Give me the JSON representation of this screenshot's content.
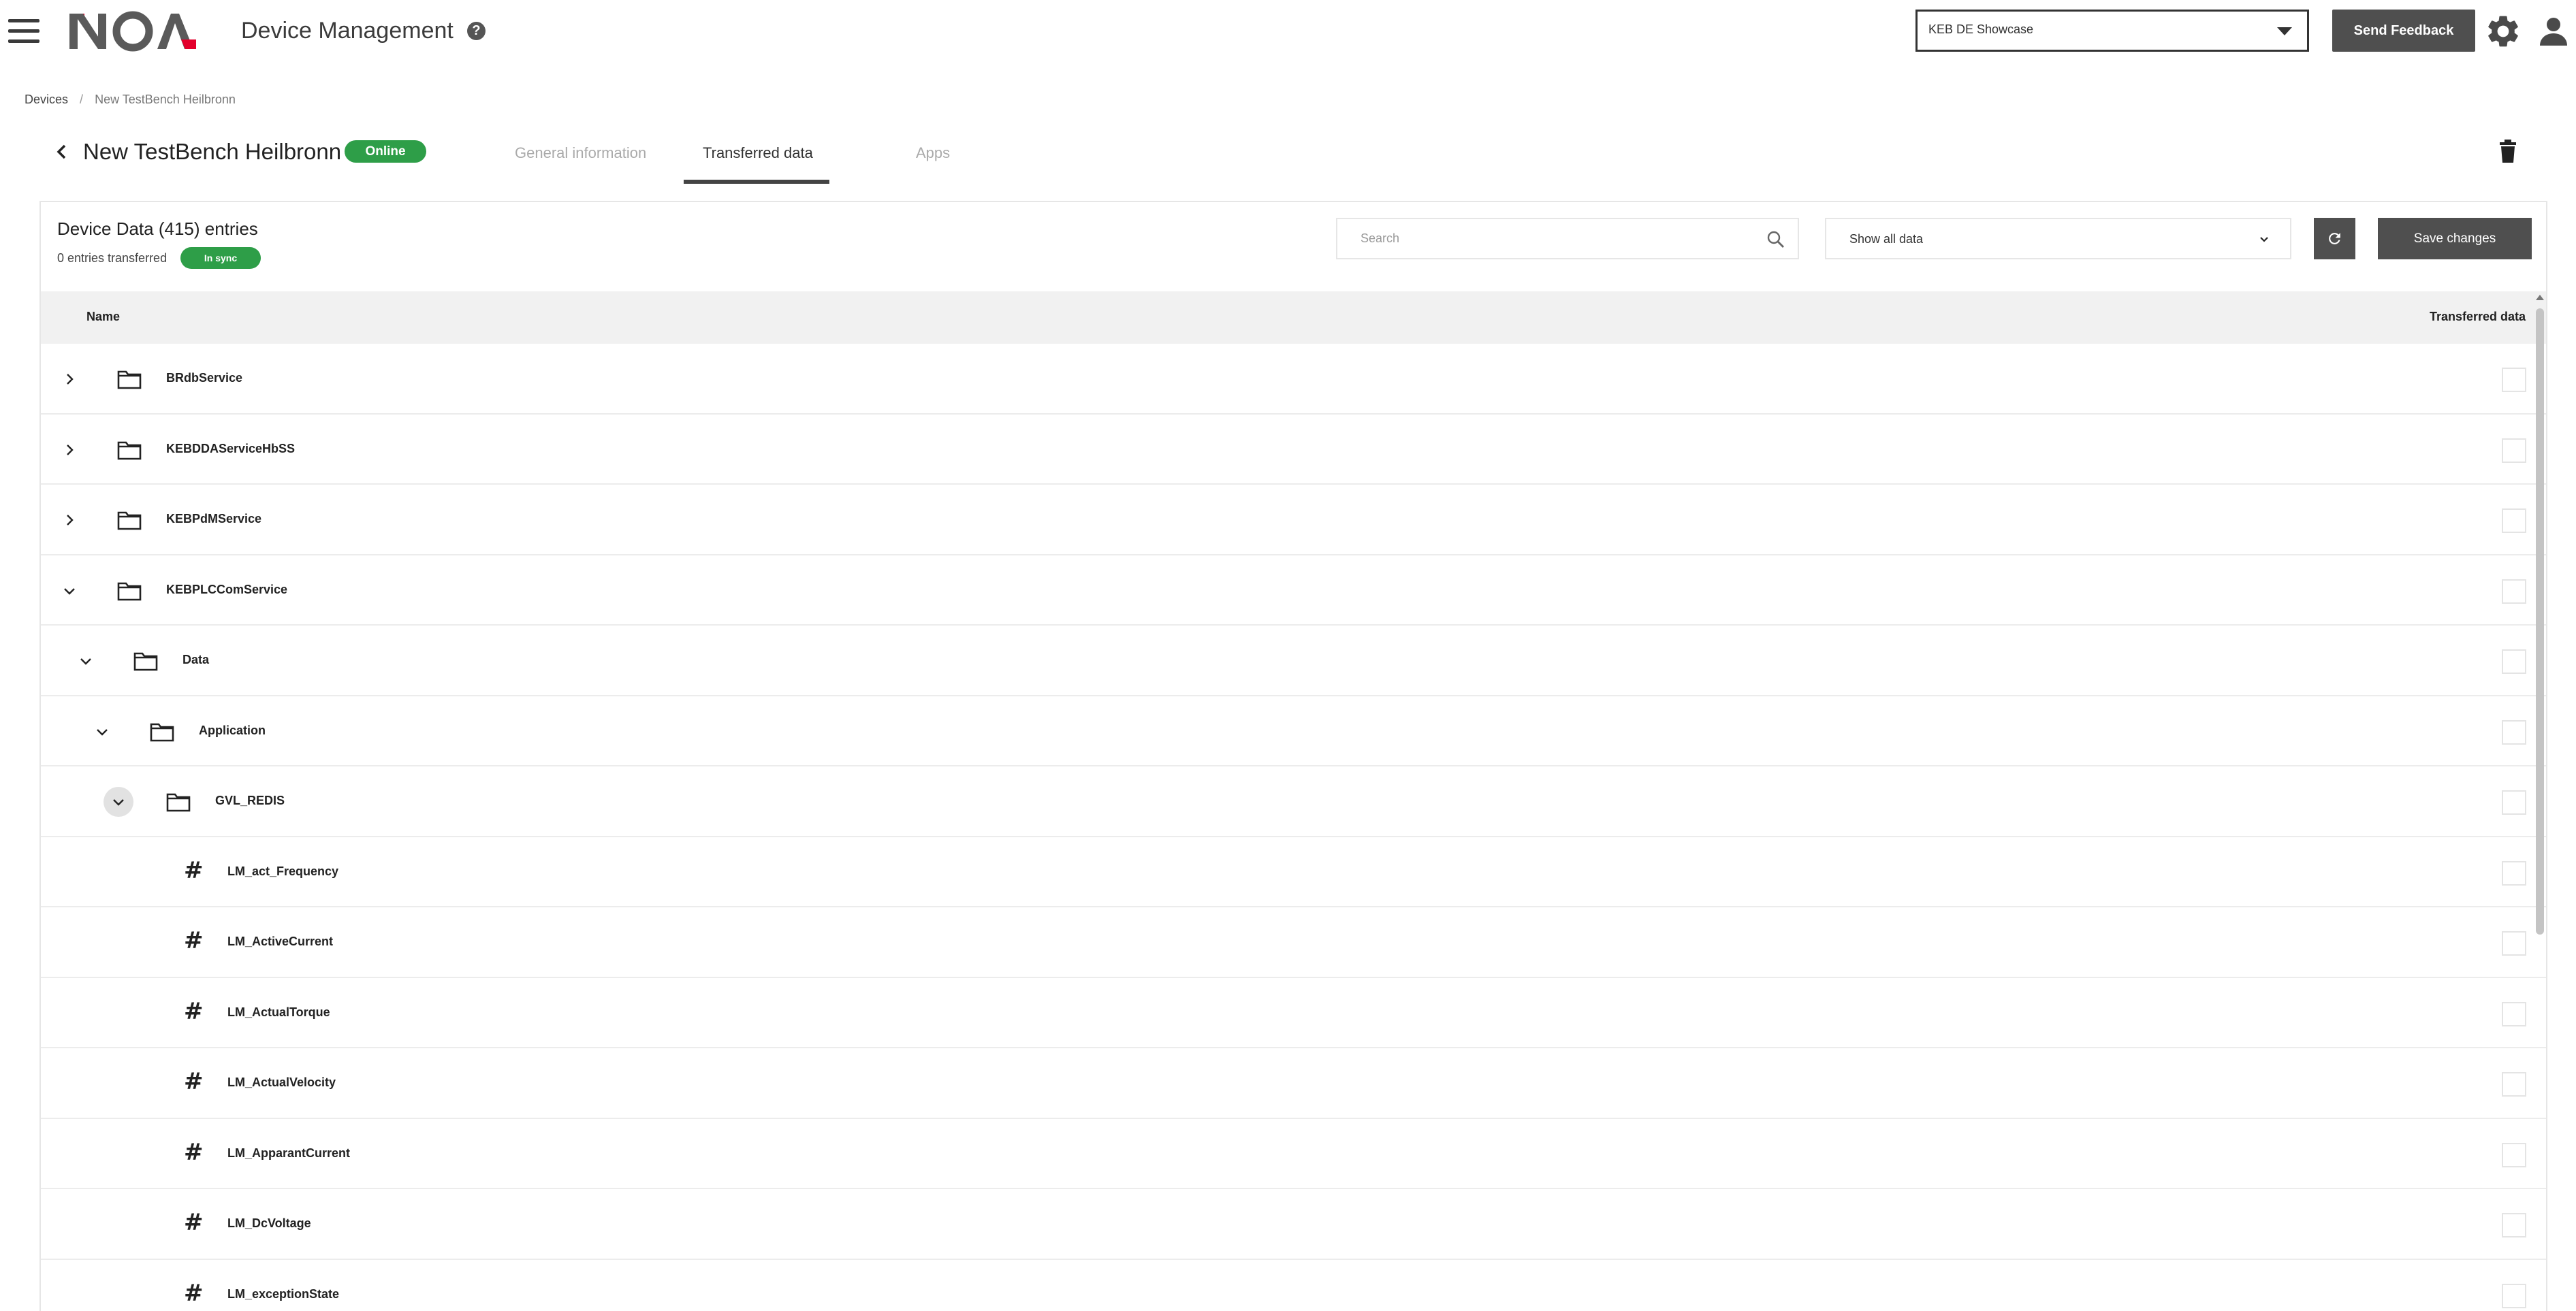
{
  "app": {
    "logo_text": "NOA",
    "title": "Device Management",
    "help_symbol": "?"
  },
  "header": {
    "tenant_selected": "KEB DE Showcase",
    "send_feedback_label": "Send Feedback"
  },
  "breadcrumb": {
    "items": [
      "Devices",
      "New TestBench Heilbronn"
    ],
    "separator": "/"
  },
  "device": {
    "name": "New TestBench Heilbronn",
    "status": "Online"
  },
  "tabs": [
    {
      "label": "General information",
      "active": false
    },
    {
      "label": "Transferred data",
      "active": true
    },
    {
      "label": "Apps",
      "active": false
    }
  ],
  "panel": {
    "title": "Device Data (415) entries",
    "subtitle": "0 entries transferred",
    "sync_status": "In sync",
    "search_placeholder": "Search",
    "filter_selected": "Show all data",
    "save_label": "Save changes"
  },
  "table": {
    "columns": {
      "name": "Name",
      "transferred": "Transferred data"
    },
    "rows": [
      {
        "label": "BRdbService",
        "type": "folder",
        "level": 0,
        "expanded": false,
        "checked": false
      },
      {
        "label": "KEBDDAServiceHbSS",
        "type": "folder",
        "level": 0,
        "expanded": false,
        "checked": false
      },
      {
        "label": "KEBPdMService",
        "type": "folder",
        "level": 0,
        "expanded": false,
        "checked": false
      },
      {
        "label": "KEBPLCComService",
        "type": "folder",
        "level": 0,
        "expanded": true,
        "checked": false
      },
      {
        "label": "Data",
        "type": "folder",
        "level": 1,
        "expanded": true,
        "checked": false
      },
      {
        "label": "Application",
        "type": "folder",
        "level": 2,
        "expanded": true,
        "checked": false
      },
      {
        "label": "GVL_REDIS",
        "type": "folder",
        "level": 3,
        "expanded": true,
        "checked": false,
        "focused": true
      },
      {
        "label": "LM_act_Frequency",
        "type": "variable",
        "level": 4,
        "checked": false
      },
      {
        "label": "LM_ActiveCurrent",
        "type": "variable",
        "level": 4,
        "checked": false
      },
      {
        "label": "LM_ActualTorque",
        "type": "variable",
        "level": 4,
        "checked": false
      },
      {
        "label": "LM_ActualVelocity",
        "type": "variable",
        "level": 4,
        "checked": false
      },
      {
        "label": "LM_ApparantCurrent",
        "type": "variable",
        "level": 4,
        "checked": false
      },
      {
        "label": "LM_DcVoltage",
        "type": "variable",
        "level": 4,
        "checked": false
      },
      {
        "label": "LM_exceptionState",
        "type": "variable",
        "level": 4,
        "checked": false
      }
    ]
  },
  "icons": {
    "menu": "hamburger-icon",
    "help": "help-circle-icon",
    "settings": "gear-icon",
    "account": "user-icon",
    "back": "chevron-left-icon",
    "delete": "trash-icon",
    "search": "search-icon",
    "refresh": "refresh-icon",
    "folder": "folder-icon",
    "variable": "hash-icon"
  },
  "colors": {
    "brand_red": "#e3002c",
    "logo_gray": "#5a5a5a",
    "status_green": "#2e9e48",
    "button_dark": "#4f4f4f"
  }
}
